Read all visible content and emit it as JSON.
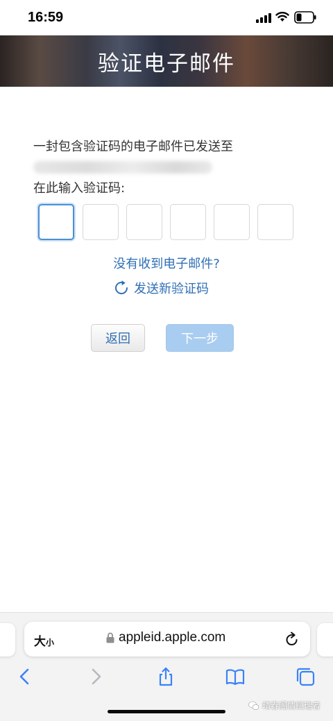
{
  "status_bar": {
    "time": "16:59"
  },
  "header": {
    "title": "验证电子邮件"
  },
  "form": {
    "intro": "一封包含验证码的电子邮件已发送至",
    "enter_code_label": "在此输入验证码:",
    "code_digit_count": 6,
    "no_email_link": "没有收到电子邮件?",
    "resend_link": "发送新验证码",
    "back_button": "返回",
    "next_button": "下一步"
  },
  "browser": {
    "text_size_big": "大",
    "text_size_small": "小",
    "url": "appleid.apple.com",
    "icons": [
      "back-icon",
      "forward-icon",
      "share-icon",
      "bookmarks-icon",
      "tabs-icon"
    ]
  },
  "watermark": {
    "text": "晴春阁情赋瑞者"
  },
  "colors": {
    "link": "#2f6fb5",
    "next_button_disabled": "#a9cdf0",
    "active_input_border": "#4a8fd4",
    "toolbar_icon": "#3b82f6"
  }
}
